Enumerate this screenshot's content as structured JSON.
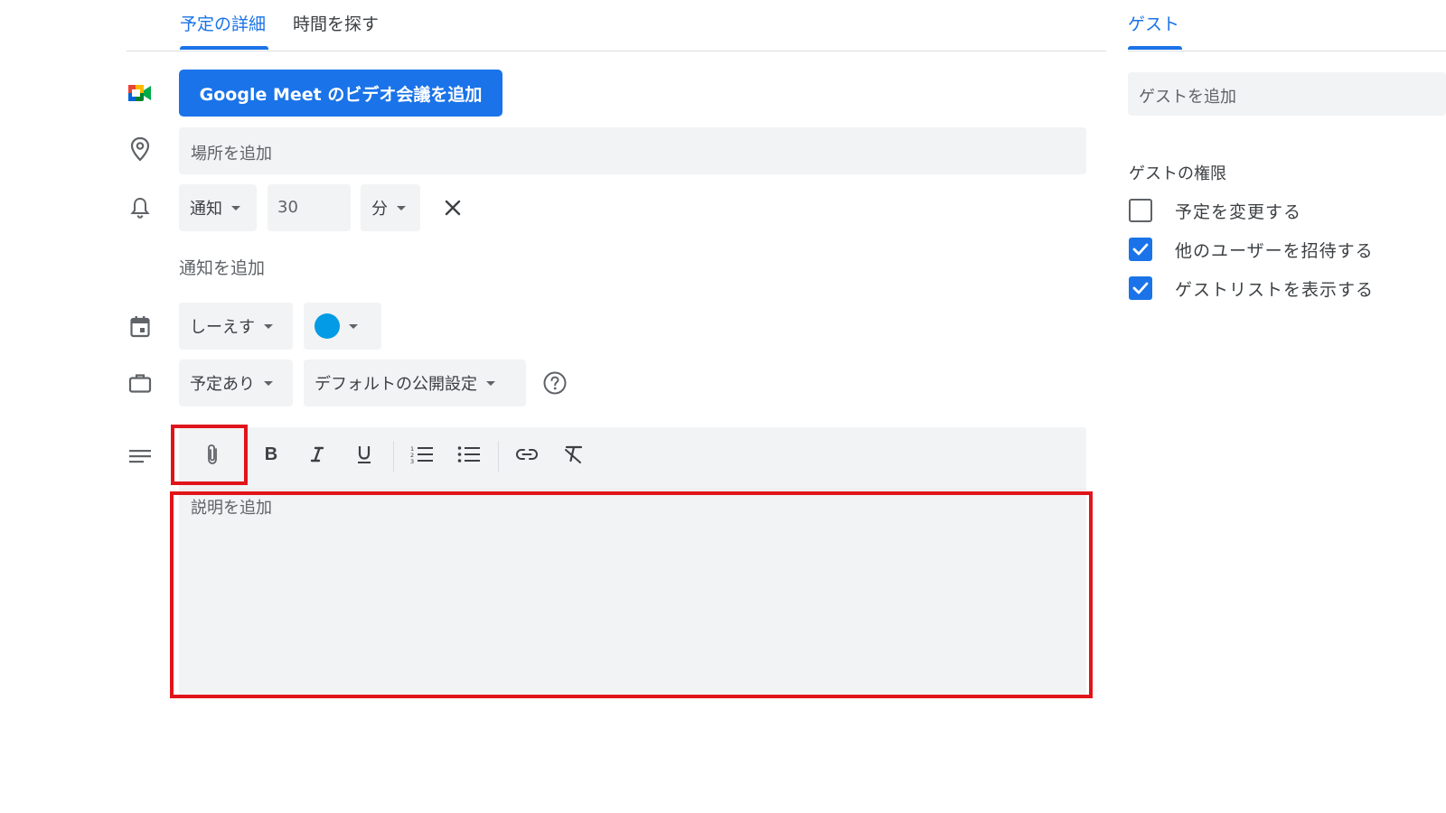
{
  "tabs": {
    "details": "予定の詳細",
    "find_time": "時間を探す",
    "guests": "ゲスト"
  },
  "meet_button": "Google Meet のビデオ会議を追加",
  "location": {
    "placeholder": "場所を追加"
  },
  "notification": {
    "type": "通知",
    "value": "30",
    "unit": "分",
    "add_label": "通知を追加"
  },
  "calendar": {
    "name": "しーえす",
    "color": "#039be5"
  },
  "availability": {
    "status": "予定あり",
    "visibility": "デフォルトの公開設定"
  },
  "description": {
    "placeholder": "説明を追加"
  },
  "guests": {
    "input_placeholder": "ゲストを追加",
    "permissions_title": "ゲストの権限",
    "permissions": [
      {
        "label": "予定を変更する",
        "checked": false
      },
      {
        "label": "他のユーザーを招待する",
        "checked": true
      },
      {
        "label": "ゲストリストを表示する",
        "checked": true
      }
    ]
  },
  "colors": {
    "accent": "#1a73e8",
    "highlight": "#e0151b",
    "field_bg": "#f1f3f4"
  }
}
